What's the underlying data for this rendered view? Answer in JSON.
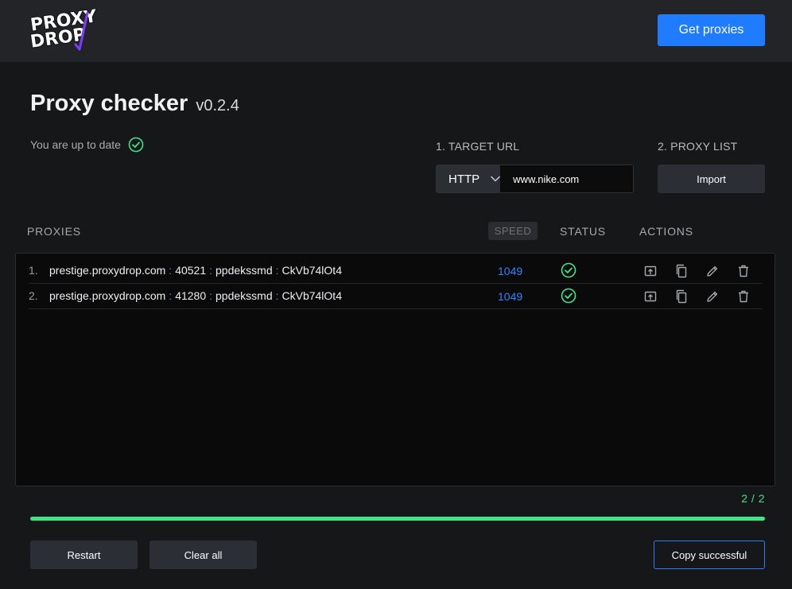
{
  "header": {
    "logo_line1": "PROXY",
    "logo_line2": "DROP",
    "get_proxies_label": "Get proxies"
  },
  "page": {
    "title": "Proxy checker",
    "version": "v0.2.4",
    "update_status": "You are up to date"
  },
  "target": {
    "label": "1. TARGET URL",
    "protocol": "HTTP",
    "url": "www.nike.com"
  },
  "proxy_list": {
    "label": "2. PROXY LIST",
    "import_label": "Import"
  },
  "table": {
    "headers": {
      "proxies": "PROXIES",
      "speed": "SPEED",
      "status": "STATUS",
      "actions": "ACTIONS"
    },
    "sep": ":",
    "rows": [
      {
        "index": "1.",
        "host": "prestige.proxydrop.com",
        "port": "40521",
        "user": "ppdekssmd",
        "pass": "CkVb74lOt4",
        "speed": "1049",
        "status": "ok"
      },
      {
        "index": "2.",
        "host": "prestige.proxydrop.com",
        "port": "41280",
        "user": "ppdekssmd",
        "pass": "CkVb74lOt4",
        "speed": "1049",
        "status": "ok"
      }
    ]
  },
  "progress": {
    "count": "2 / 2",
    "fraction": 1.0
  },
  "footer": {
    "restart_label": "Restart",
    "clear_label": "Clear all",
    "copy_label": "Copy successful"
  },
  "colors": {
    "accent": "#1f7bff",
    "success": "#3ee58b",
    "speed": "#2f86ff"
  }
}
